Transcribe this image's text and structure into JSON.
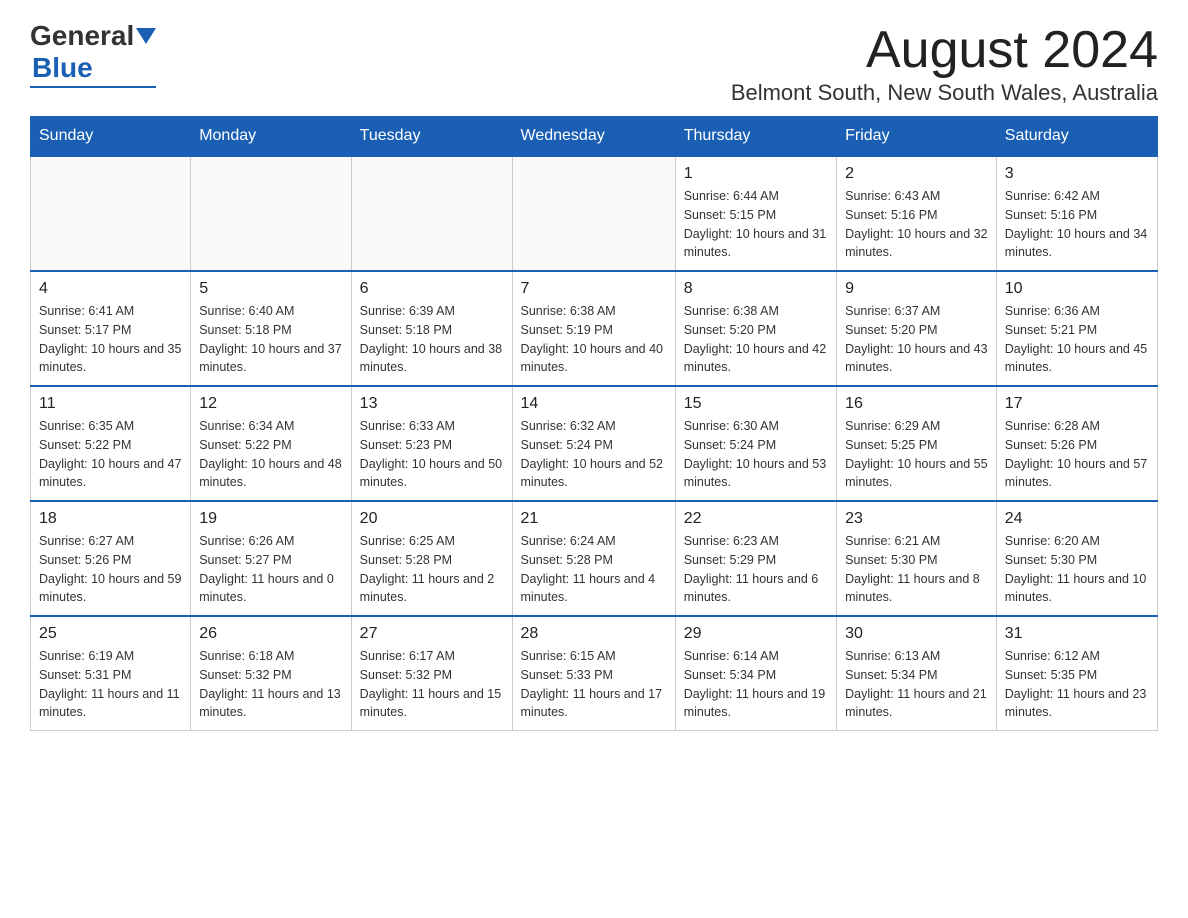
{
  "header": {
    "logo_general": "General",
    "logo_blue": "Blue",
    "month_title": "August 2024",
    "subtitle": "Belmont South, New South Wales, Australia"
  },
  "days_of_week": [
    "Sunday",
    "Monday",
    "Tuesday",
    "Wednesday",
    "Thursday",
    "Friday",
    "Saturday"
  ],
  "weeks": [
    [
      {
        "day": "",
        "info": ""
      },
      {
        "day": "",
        "info": ""
      },
      {
        "day": "",
        "info": ""
      },
      {
        "day": "",
        "info": ""
      },
      {
        "day": "1",
        "info": "Sunrise: 6:44 AM\nSunset: 5:15 PM\nDaylight: 10 hours and 31 minutes."
      },
      {
        "day": "2",
        "info": "Sunrise: 6:43 AM\nSunset: 5:16 PM\nDaylight: 10 hours and 32 minutes."
      },
      {
        "day": "3",
        "info": "Sunrise: 6:42 AM\nSunset: 5:16 PM\nDaylight: 10 hours and 34 minutes."
      }
    ],
    [
      {
        "day": "4",
        "info": "Sunrise: 6:41 AM\nSunset: 5:17 PM\nDaylight: 10 hours and 35 minutes."
      },
      {
        "day": "5",
        "info": "Sunrise: 6:40 AM\nSunset: 5:18 PM\nDaylight: 10 hours and 37 minutes."
      },
      {
        "day": "6",
        "info": "Sunrise: 6:39 AM\nSunset: 5:18 PM\nDaylight: 10 hours and 38 minutes."
      },
      {
        "day": "7",
        "info": "Sunrise: 6:38 AM\nSunset: 5:19 PM\nDaylight: 10 hours and 40 minutes."
      },
      {
        "day": "8",
        "info": "Sunrise: 6:38 AM\nSunset: 5:20 PM\nDaylight: 10 hours and 42 minutes."
      },
      {
        "day": "9",
        "info": "Sunrise: 6:37 AM\nSunset: 5:20 PM\nDaylight: 10 hours and 43 minutes."
      },
      {
        "day": "10",
        "info": "Sunrise: 6:36 AM\nSunset: 5:21 PM\nDaylight: 10 hours and 45 minutes."
      }
    ],
    [
      {
        "day": "11",
        "info": "Sunrise: 6:35 AM\nSunset: 5:22 PM\nDaylight: 10 hours and 47 minutes."
      },
      {
        "day": "12",
        "info": "Sunrise: 6:34 AM\nSunset: 5:22 PM\nDaylight: 10 hours and 48 minutes."
      },
      {
        "day": "13",
        "info": "Sunrise: 6:33 AM\nSunset: 5:23 PM\nDaylight: 10 hours and 50 minutes."
      },
      {
        "day": "14",
        "info": "Sunrise: 6:32 AM\nSunset: 5:24 PM\nDaylight: 10 hours and 52 minutes."
      },
      {
        "day": "15",
        "info": "Sunrise: 6:30 AM\nSunset: 5:24 PM\nDaylight: 10 hours and 53 minutes."
      },
      {
        "day": "16",
        "info": "Sunrise: 6:29 AM\nSunset: 5:25 PM\nDaylight: 10 hours and 55 minutes."
      },
      {
        "day": "17",
        "info": "Sunrise: 6:28 AM\nSunset: 5:26 PM\nDaylight: 10 hours and 57 minutes."
      }
    ],
    [
      {
        "day": "18",
        "info": "Sunrise: 6:27 AM\nSunset: 5:26 PM\nDaylight: 10 hours and 59 minutes."
      },
      {
        "day": "19",
        "info": "Sunrise: 6:26 AM\nSunset: 5:27 PM\nDaylight: 11 hours and 0 minutes."
      },
      {
        "day": "20",
        "info": "Sunrise: 6:25 AM\nSunset: 5:28 PM\nDaylight: 11 hours and 2 minutes."
      },
      {
        "day": "21",
        "info": "Sunrise: 6:24 AM\nSunset: 5:28 PM\nDaylight: 11 hours and 4 minutes."
      },
      {
        "day": "22",
        "info": "Sunrise: 6:23 AM\nSunset: 5:29 PM\nDaylight: 11 hours and 6 minutes."
      },
      {
        "day": "23",
        "info": "Sunrise: 6:21 AM\nSunset: 5:30 PM\nDaylight: 11 hours and 8 minutes."
      },
      {
        "day": "24",
        "info": "Sunrise: 6:20 AM\nSunset: 5:30 PM\nDaylight: 11 hours and 10 minutes."
      }
    ],
    [
      {
        "day": "25",
        "info": "Sunrise: 6:19 AM\nSunset: 5:31 PM\nDaylight: 11 hours and 11 minutes."
      },
      {
        "day": "26",
        "info": "Sunrise: 6:18 AM\nSunset: 5:32 PM\nDaylight: 11 hours and 13 minutes."
      },
      {
        "day": "27",
        "info": "Sunrise: 6:17 AM\nSunset: 5:32 PM\nDaylight: 11 hours and 15 minutes."
      },
      {
        "day": "28",
        "info": "Sunrise: 6:15 AM\nSunset: 5:33 PM\nDaylight: 11 hours and 17 minutes."
      },
      {
        "day": "29",
        "info": "Sunrise: 6:14 AM\nSunset: 5:34 PM\nDaylight: 11 hours and 19 minutes."
      },
      {
        "day": "30",
        "info": "Sunrise: 6:13 AM\nSunset: 5:34 PM\nDaylight: 11 hours and 21 minutes."
      },
      {
        "day": "31",
        "info": "Sunrise: 6:12 AM\nSunset: 5:35 PM\nDaylight: 11 hours and 23 minutes."
      }
    ]
  ]
}
